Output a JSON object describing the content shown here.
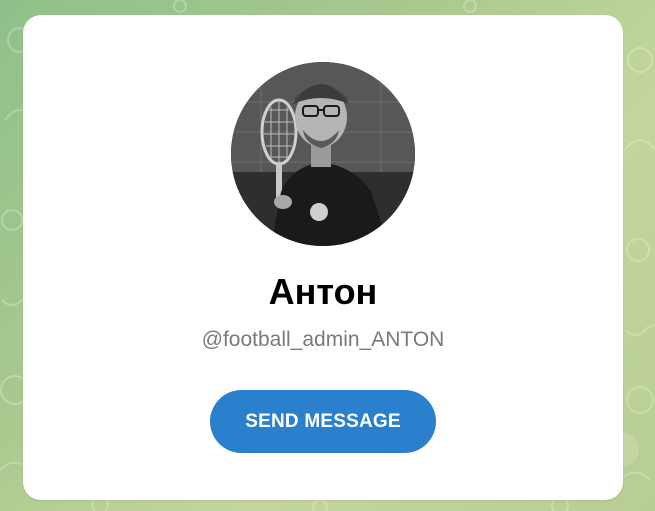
{
  "profile": {
    "name": "Антон",
    "username": "@football_admin_ANTON",
    "avatar": "profile-photo"
  },
  "actions": {
    "send_message_label": "SEND MESSAGE"
  },
  "colors": {
    "accent": "#2a80cc",
    "card": "#ffffff",
    "username_text": "#7a7a7a",
    "background": "#a8c98e"
  }
}
